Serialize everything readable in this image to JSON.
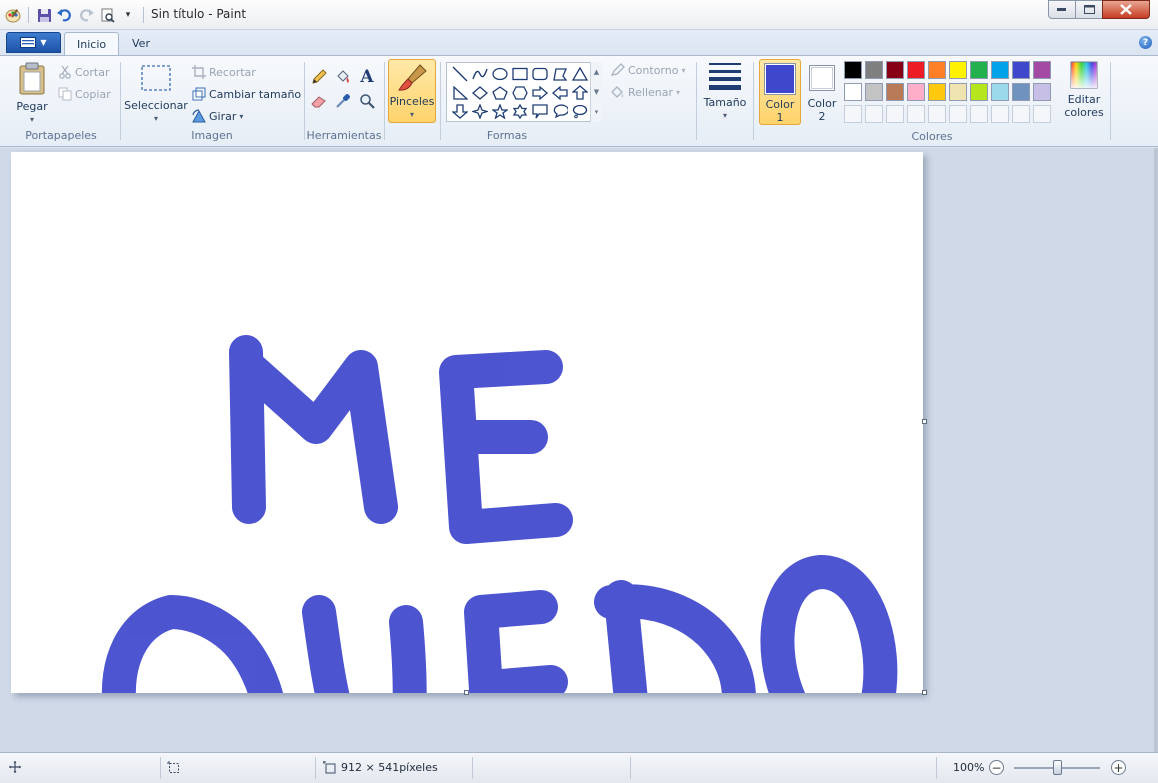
{
  "window": {
    "title": "Sin título - Paint"
  },
  "tabs": {
    "home": "Inicio",
    "view": "Ver"
  },
  "ribbon": {
    "clipboard": {
      "label": "Portapapeles",
      "paste": "Pegar",
      "cut": "Cortar",
      "copy": "Copiar"
    },
    "image": {
      "label": "Imagen",
      "select": "Seleccionar",
      "crop": "Recortar",
      "resize": "Cambiar tamaño",
      "rotate": "Girar"
    },
    "tools": {
      "label": "Herramientas",
      "items": [
        "pencil-icon",
        "fill-bucket-icon",
        "text-icon",
        "eraser-icon",
        "color-picker-icon",
        "magnifier-icon"
      ]
    },
    "brushes": {
      "label": "Pinceles"
    },
    "shapes": {
      "label": "Formas",
      "outline": "Contorno",
      "fill": "Rellenar"
    },
    "size": {
      "label": "Tamaño"
    },
    "colors": {
      "label": "Colores",
      "color1": "Color 1",
      "color2": "Color 2",
      "edit": "Editar colores",
      "color1_value": "#3f48cc",
      "color2_value": "#ffffff",
      "palette_row1": [
        "#000000",
        "#7f7f7f",
        "#880015",
        "#ed1c24",
        "#ff7f27",
        "#fff200",
        "#22b14c",
        "#00a2e8",
        "#3f48cc",
        "#a349a4"
      ],
      "palette_row2": [
        "#ffffff",
        "#c3c3c3",
        "#b97a57",
        "#ffaec9",
        "#ffc90e",
        "#efe4b0",
        "#b5e61d",
        "#99d9ea",
        "#7092be",
        "#c8bfe7"
      ]
    }
  },
  "canvas": {
    "paint_color": "#3f48cc",
    "line1": "ME",
    "line2": "QUEDO"
  },
  "status": {
    "dimensions": "912 × 541píxeles",
    "zoom": "100%"
  }
}
